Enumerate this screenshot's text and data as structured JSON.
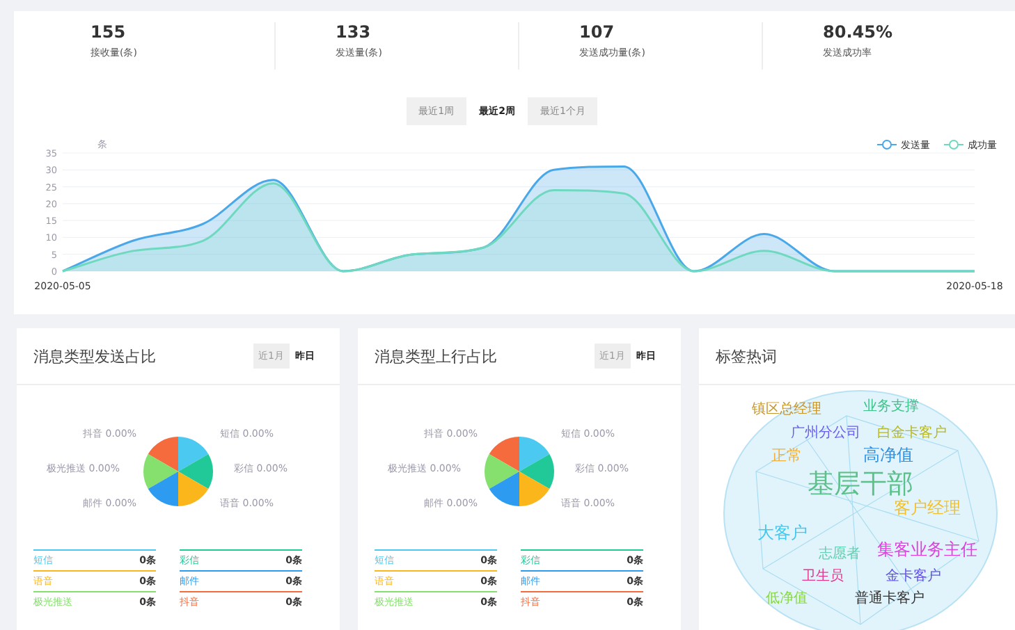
{
  "stats": [
    {
      "value": "155",
      "label": "接收量(条)"
    },
    {
      "value": "133",
      "label": "发送量(条)"
    },
    {
      "value": "107",
      "label": "发送成功量(条)"
    },
    {
      "value": "80.45%",
      "label": "发送成功率"
    }
  ],
  "range_tabs": [
    {
      "label": "最近1周",
      "selected": false
    },
    {
      "label": "最近2周",
      "selected": true
    },
    {
      "label": "最近1个月",
      "selected": false
    }
  ],
  "trend": {
    "chart_data": {
      "type": "area",
      "grid": true,
      "legend": true,
      "ylabel": "条",
      "categories": [
        "2020-05-05",
        null,
        null,
        null,
        null,
        null,
        null,
        null,
        null,
        null,
        null,
        null,
        null,
        "2020-05-18"
      ],
      "yticks": [
        0,
        5,
        10,
        15,
        20,
        25,
        30,
        35
      ],
      "ylim": [
        0,
        35
      ],
      "series": [
        {
          "name": "发送量",
          "color": "#4aa8e8",
          "values": [
            0,
            9,
            14,
            27,
            0,
            5,
            7,
            30,
            31,
            0,
            11,
            0,
            0,
            0
          ]
        },
        {
          "name": "成功量",
          "color": "#6fd9c0",
          "values": [
            0,
            6,
            9,
            26,
            0,
            5,
            7,
            24,
            23,
            0,
            6,
            0,
            0,
            0
          ]
        }
      ]
    }
  },
  "panels": [
    {
      "title": "消息类型发送占比",
      "tabs": [
        {
          "label": "近1月",
          "selected": false
        },
        {
          "label": "昨日",
          "selected": true
        }
      ],
      "slices": [
        {
          "label": "抖音",
          "percent": "0.00%",
          "color": "#f56b3d"
        },
        {
          "label": "短信",
          "percent": "0.00%",
          "color": "#4cc9f0"
        },
        {
          "label": "极光推送",
          "percent": "0.00%",
          "color": "#86e06e"
        },
        {
          "label": "彩信",
          "percent": "0.00%",
          "color": "#20c997"
        },
        {
          "label": "邮件",
          "percent": "0.00%",
          "color": "#2d9bf0"
        },
        {
          "label": "语音",
          "percent": "0.00%",
          "color": "#fbb61c"
        }
      ],
      "legend": [
        {
          "name": "短信",
          "count": "0条",
          "color": "#4cc9f0"
        },
        {
          "name": "彩信",
          "count": "0条",
          "color": "#20c997"
        },
        {
          "name": "语音",
          "count": "0条",
          "color": "#fbb61c"
        },
        {
          "name": "邮件",
          "count": "0条",
          "color": "#2d9bf0"
        },
        {
          "name": "极光推送",
          "count": "0条",
          "color": "#86e06e"
        },
        {
          "name": "抖音",
          "count": "0条",
          "color": "#f56b3d"
        }
      ]
    },
    {
      "title": "消息类型上行占比",
      "tabs": [
        {
          "label": "近1月",
          "selected": false
        },
        {
          "label": "昨日",
          "selected": true
        }
      ],
      "slices": [
        {
          "label": "抖音",
          "percent": "0.00%",
          "color": "#f56b3d"
        },
        {
          "label": "短信",
          "percent": "0.00%",
          "color": "#4cc9f0"
        },
        {
          "label": "极光推送",
          "percent": "0.00%",
          "color": "#86e06e"
        },
        {
          "label": "彩信",
          "percent": "0.00%",
          "color": "#20c997"
        },
        {
          "label": "邮件",
          "percent": "0.00%",
          "color": "#2d9bf0"
        },
        {
          "label": "语音",
          "percent": "0.00%",
          "color": "#fbb61c"
        }
      ],
      "legend": [
        {
          "name": "短信",
          "count": "0条",
          "color": "#4cc9f0"
        },
        {
          "name": "彩信",
          "count": "0条",
          "color": "#20c997"
        },
        {
          "name": "语音",
          "count": "0条",
          "color": "#fbb61c"
        },
        {
          "name": "邮件",
          "count": "0条",
          "color": "#2d9bf0"
        },
        {
          "name": "极光推送",
          "count": "0条",
          "color": "#86e06e"
        },
        {
          "name": "抖音",
          "count": "0条",
          "color": "#f56b3d"
        }
      ]
    }
  ],
  "tag_cloud": {
    "title": "标签热词",
    "words": [
      {
        "text": "镇区总经理",
        "color": "#c8962a"
      },
      {
        "text": "业务支撑",
        "color": "#3cc48a"
      },
      {
        "text": "广州分公司",
        "color": "#6a5cf0"
      },
      {
        "text": "白金卡客户",
        "color": "#b8b820"
      },
      {
        "text": "正常",
        "color": "#f0b040"
      },
      {
        "text": "高净值",
        "color": "#2f8fe0"
      },
      {
        "text": "基层干部",
        "color": "#5cc08a"
      },
      {
        "text": "客户经理",
        "color": "#f0c030"
      },
      {
        "text": "大客户",
        "color": "#40c8f0"
      },
      {
        "text": "志愿者",
        "color": "#60d0b0"
      },
      {
        "text": "集客业务主任",
        "color": "#e040e0"
      },
      {
        "text": "卫生员",
        "color": "#e03890"
      },
      {
        "text": "金卡客户",
        "color": "#6050e8"
      },
      {
        "text": "低净值",
        "color": "#88d840"
      },
      {
        "text": "普通卡客户",
        "color": "#333333"
      }
    ]
  }
}
